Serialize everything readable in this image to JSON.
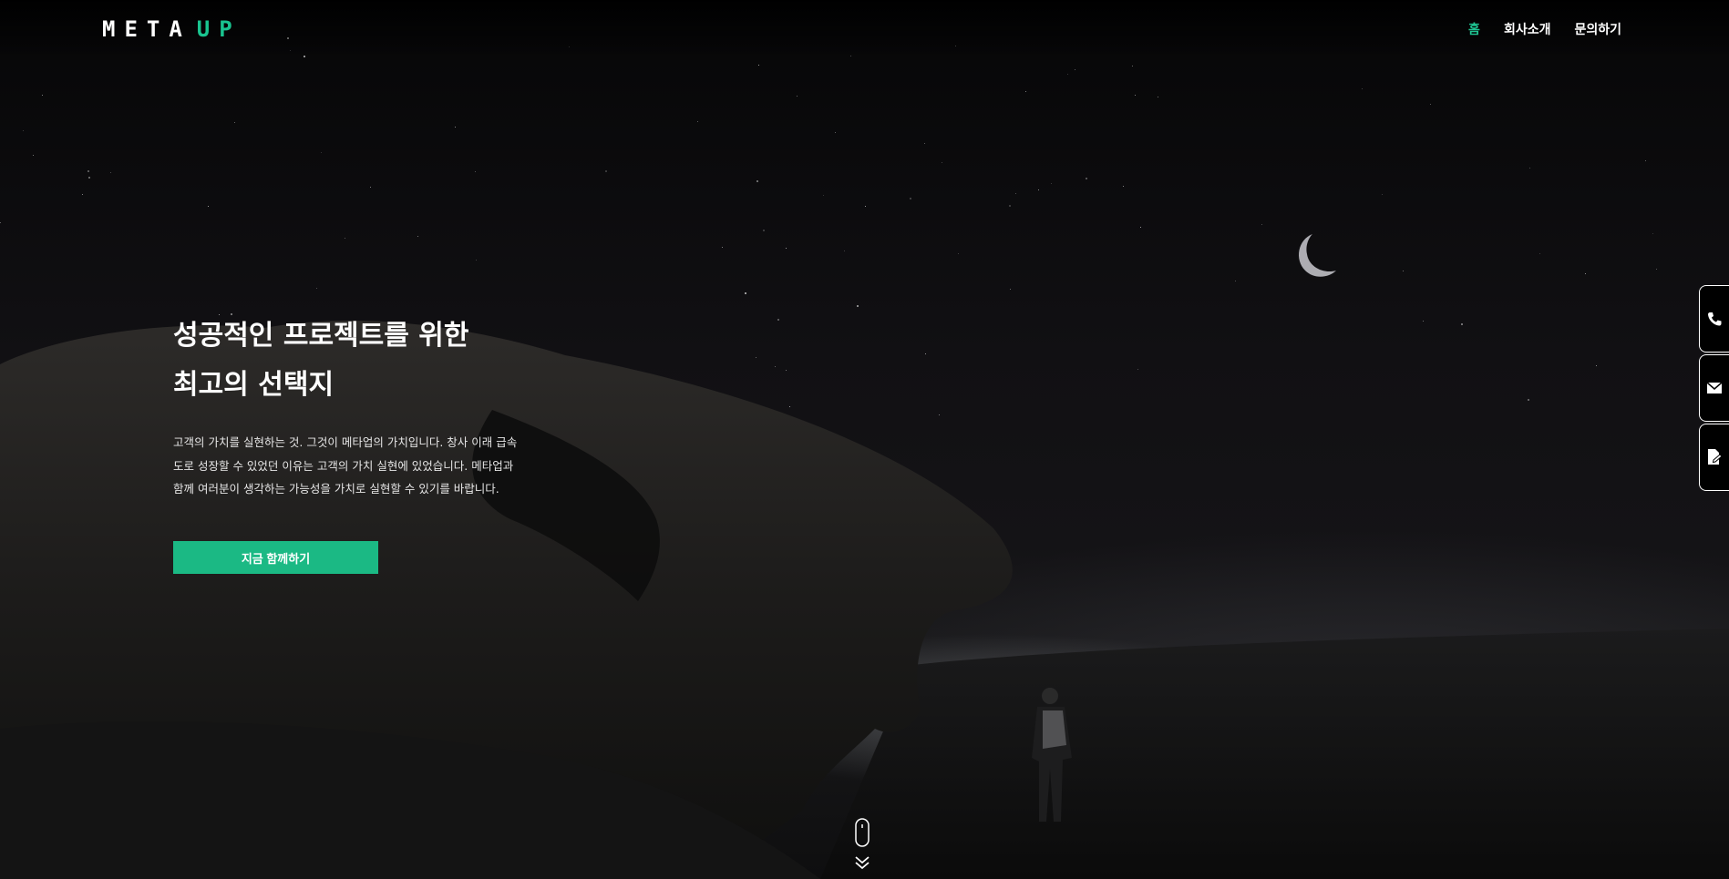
{
  "logo": {
    "part1": "META",
    "part2": "UP"
  },
  "nav": [
    {
      "label": "홈",
      "active": true
    },
    {
      "label": "회사소개",
      "active": false
    },
    {
      "label": "문의하기",
      "active": false
    }
  ],
  "hero": {
    "headline_line1": "성공적인 프로젝트를 위한",
    "headline_line2": "최고의 선택지",
    "desc_line1": "고객의 가치를 실현하는 것. 그것이 메타업의 가치입니다. 창사 이래 급속",
    "desc_line2": "도로 성장할 수 있었던 이유는 고객의 가치 실현에 있었습니다. 메타업과",
    "desc_line3": "함께 여러분이 생각하는 가능성을 가치로 실현할 수 있기를 바랍니다.",
    "cta_label": "지금 함께하기"
  },
  "side_buttons": [
    {
      "icon": "phone-icon"
    },
    {
      "icon": "mail-icon"
    },
    {
      "icon": "document-icon"
    }
  ],
  "colors": {
    "accent": "#1fc593",
    "button": "#1bb984",
    "background": "#0b0b0c"
  }
}
